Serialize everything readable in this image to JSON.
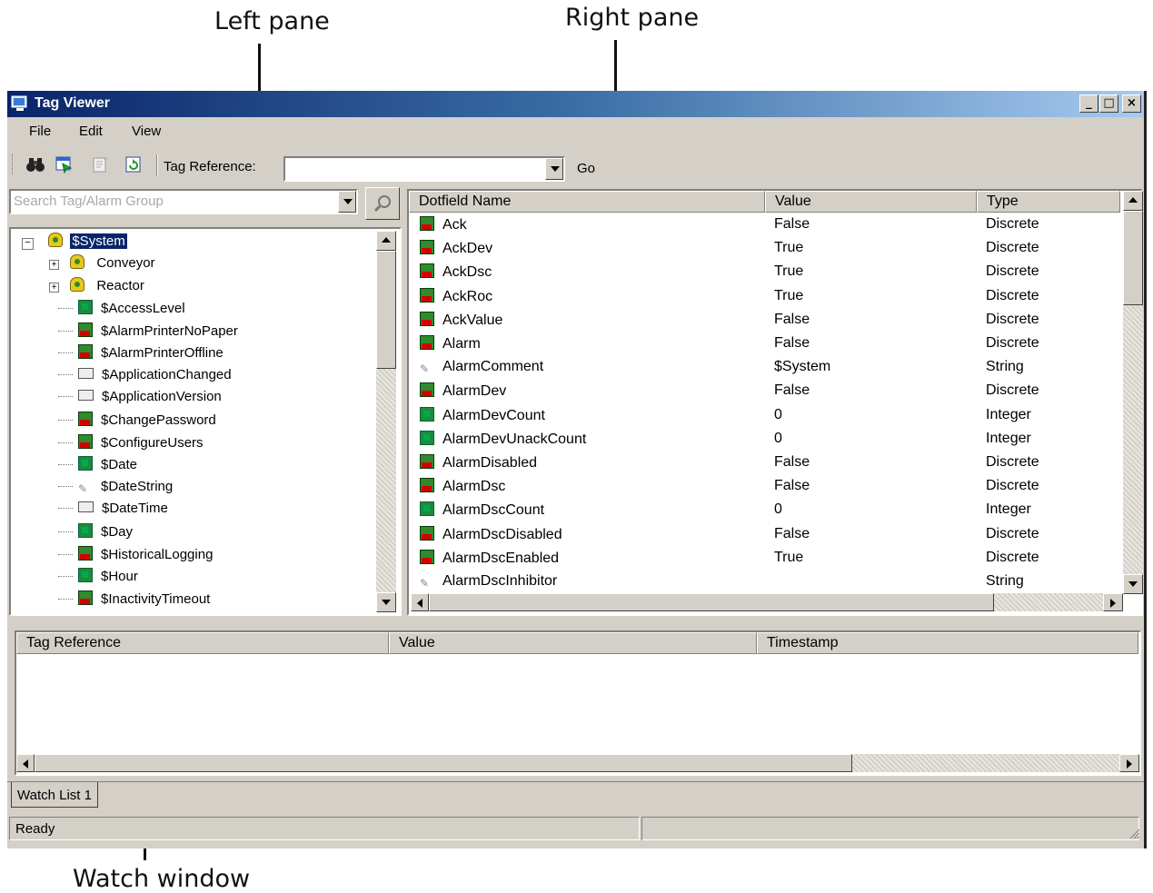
{
  "callouts": {
    "left_pane": "Left pane",
    "right_pane": "Right pane",
    "watch_window": "Watch window"
  },
  "window": {
    "title": "Tag Viewer",
    "controls": {
      "minimize": "_",
      "maximize": "□",
      "close": "×"
    }
  },
  "menu": [
    "File",
    "Edit",
    "View"
  ],
  "toolbar": {
    "icons": [
      "binoculars-icon",
      "tag-browser-icon",
      "properties-icon",
      "refresh-icon"
    ],
    "tag_reference_label": "Tag Reference:",
    "tag_reference_value": "",
    "go_label": "Go"
  },
  "search": {
    "placeholder": "Search Tag/Alarm Group"
  },
  "tree": {
    "root": "$System",
    "groups": [
      "Conveyor",
      "Reactor"
    ],
    "items": [
      {
        "label": "$AccessLevel",
        "icon": "integer"
      },
      {
        "label": "$AlarmPrinterNoPaper",
        "icon": "discrete"
      },
      {
        "label": "$AlarmPrinterOffline",
        "icon": "discrete"
      },
      {
        "label": "$ApplicationChanged",
        "icon": "message"
      },
      {
        "label": "$ApplicationVersion",
        "icon": "message"
      },
      {
        "label": "$ChangePassword",
        "icon": "discrete"
      },
      {
        "label": "$ConfigureUsers",
        "icon": "discrete"
      },
      {
        "label": "$Date",
        "icon": "integer"
      },
      {
        "label": "$DateString",
        "icon": "string"
      },
      {
        "label": "$DateTime",
        "icon": "message"
      },
      {
        "label": "$Day",
        "icon": "integer"
      },
      {
        "label": "$HistoricalLogging",
        "icon": "discrete"
      },
      {
        "label": "$Hour",
        "icon": "integer"
      },
      {
        "label": "$InactivityTimeout",
        "icon": "discrete"
      }
    ]
  },
  "grid": {
    "columns": [
      "Dotfield Name",
      "Value",
      "Type"
    ],
    "rows": [
      {
        "name": "Ack",
        "value": "False",
        "type": "Discrete",
        "icon": "discrete"
      },
      {
        "name": "AckDev",
        "value": "True",
        "type": "Discrete",
        "icon": "discrete"
      },
      {
        "name": "AckDsc",
        "value": "True",
        "type": "Discrete",
        "icon": "discrete"
      },
      {
        "name": "AckRoc",
        "value": "True",
        "type": "Discrete",
        "icon": "discrete"
      },
      {
        "name": "AckValue",
        "value": "False",
        "type": "Discrete",
        "icon": "discrete"
      },
      {
        "name": "Alarm",
        "value": "False",
        "type": "Discrete",
        "icon": "discrete"
      },
      {
        "name": "AlarmComment",
        "value": "$System",
        "type": "String",
        "icon": "string"
      },
      {
        "name": "AlarmDev",
        "value": "False",
        "type": "Discrete",
        "icon": "discrete"
      },
      {
        "name": "AlarmDevCount",
        "value": "0",
        "type": "Integer",
        "icon": "integer"
      },
      {
        "name": "AlarmDevUnackCount",
        "value": "0",
        "type": "Integer",
        "icon": "integer"
      },
      {
        "name": "AlarmDisabled",
        "value": "False",
        "type": "Discrete",
        "icon": "discrete"
      },
      {
        "name": "AlarmDsc",
        "value": "False",
        "type": "Discrete",
        "icon": "discrete"
      },
      {
        "name": "AlarmDscCount",
        "value": "0",
        "type": "Integer",
        "icon": "integer"
      },
      {
        "name": "AlarmDscDisabled",
        "value": "False",
        "type": "Discrete",
        "icon": "discrete"
      },
      {
        "name": "AlarmDscEnabled",
        "value": "True",
        "type": "Discrete",
        "icon": "discrete"
      },
      {
        "name": "AlarmDscInhibitor",
        "value": "",
        "type": "String",
        "icon": "string"
      }
    ]
  },
  "watch": {
    "columns": [
      "Tag Reference",
      "Value",
      "Timestamp"
    ],
    "tab": "Watch List 1"
  },
  "status": {
    "text": "Ready"
  }
}
